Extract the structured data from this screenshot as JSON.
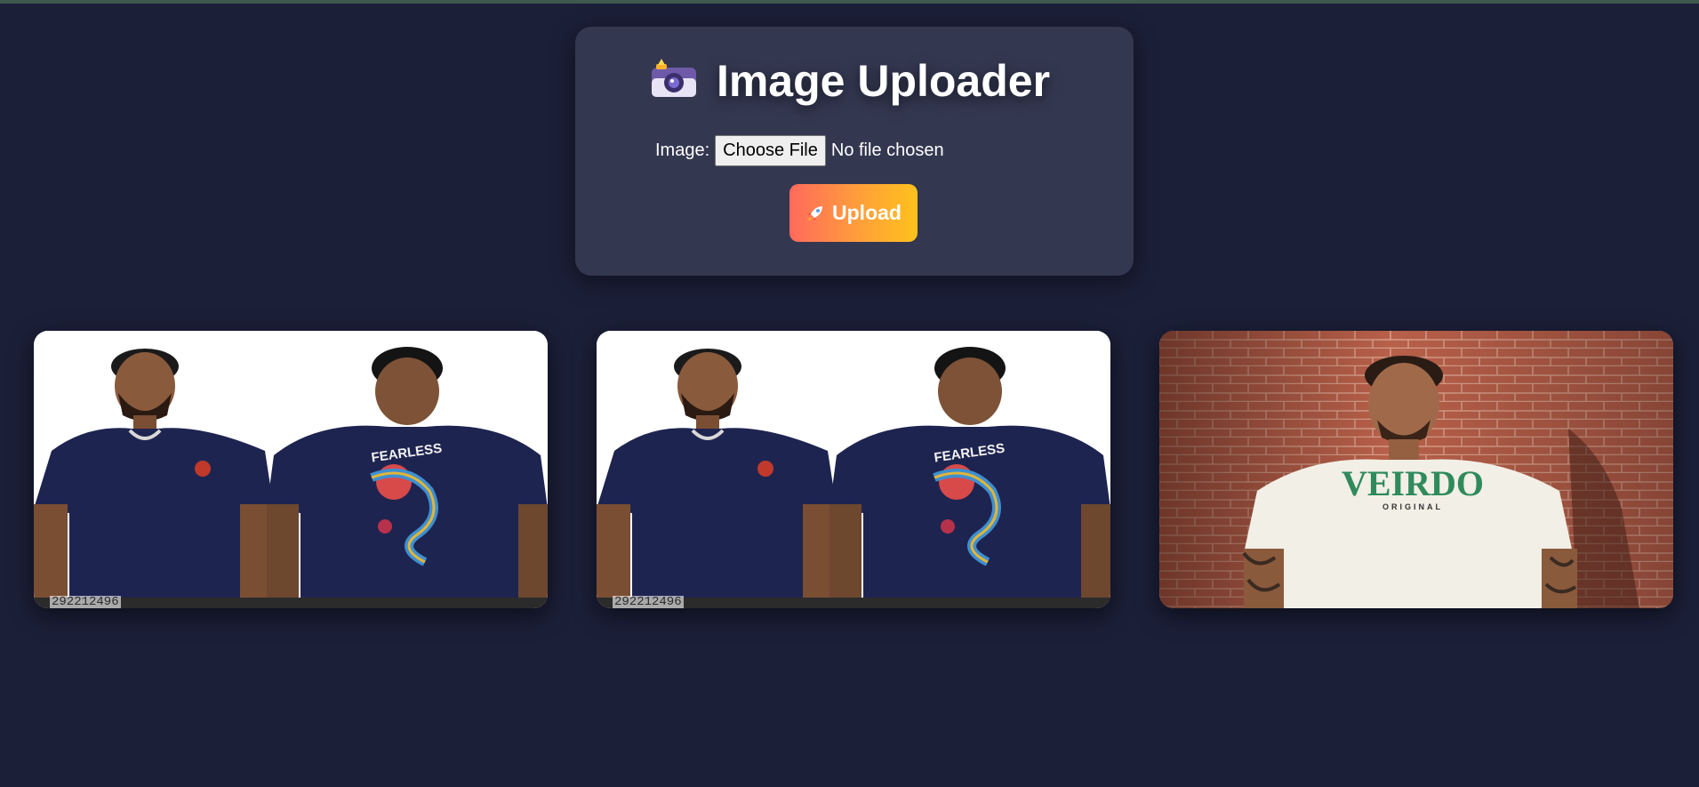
{
  "header": {
    "title": "Image Uploader",
    "title_icon": "camera-with-flash-icon"
  },
  "upload_form": {
    "image_label": "Image:",
    "choose_file_label": "Choose File",
    "no_file_text": "No file chosen",
    "upload_button_label": "Upload",
    "upload_button_icon": "rocket-icon",
    "button_gradient": [
      "#ff6a5c",
      "#ffc21c"
    ]
  },
  "gallery": {
    "images": [
      {
        "description_icon": "photo-two-men-navy-tshirts",
        "watermark": "292212496"
      },
      {
        "description_icon": "photo-two-men-navy-tshirts",
        "watermark": "292212496"
      },
      {
        "description_icon": "photo-man-white-tshirt-brick-wall",
        "shirt_text": "VEIRDO",
        "shirt_subtext": "ORIGINAL"
      }
    ]
  },
  "colors": {
    "background": "#1b1f38",
    "panel": "#333750",
    "text": "#ffffff"
  }
}
